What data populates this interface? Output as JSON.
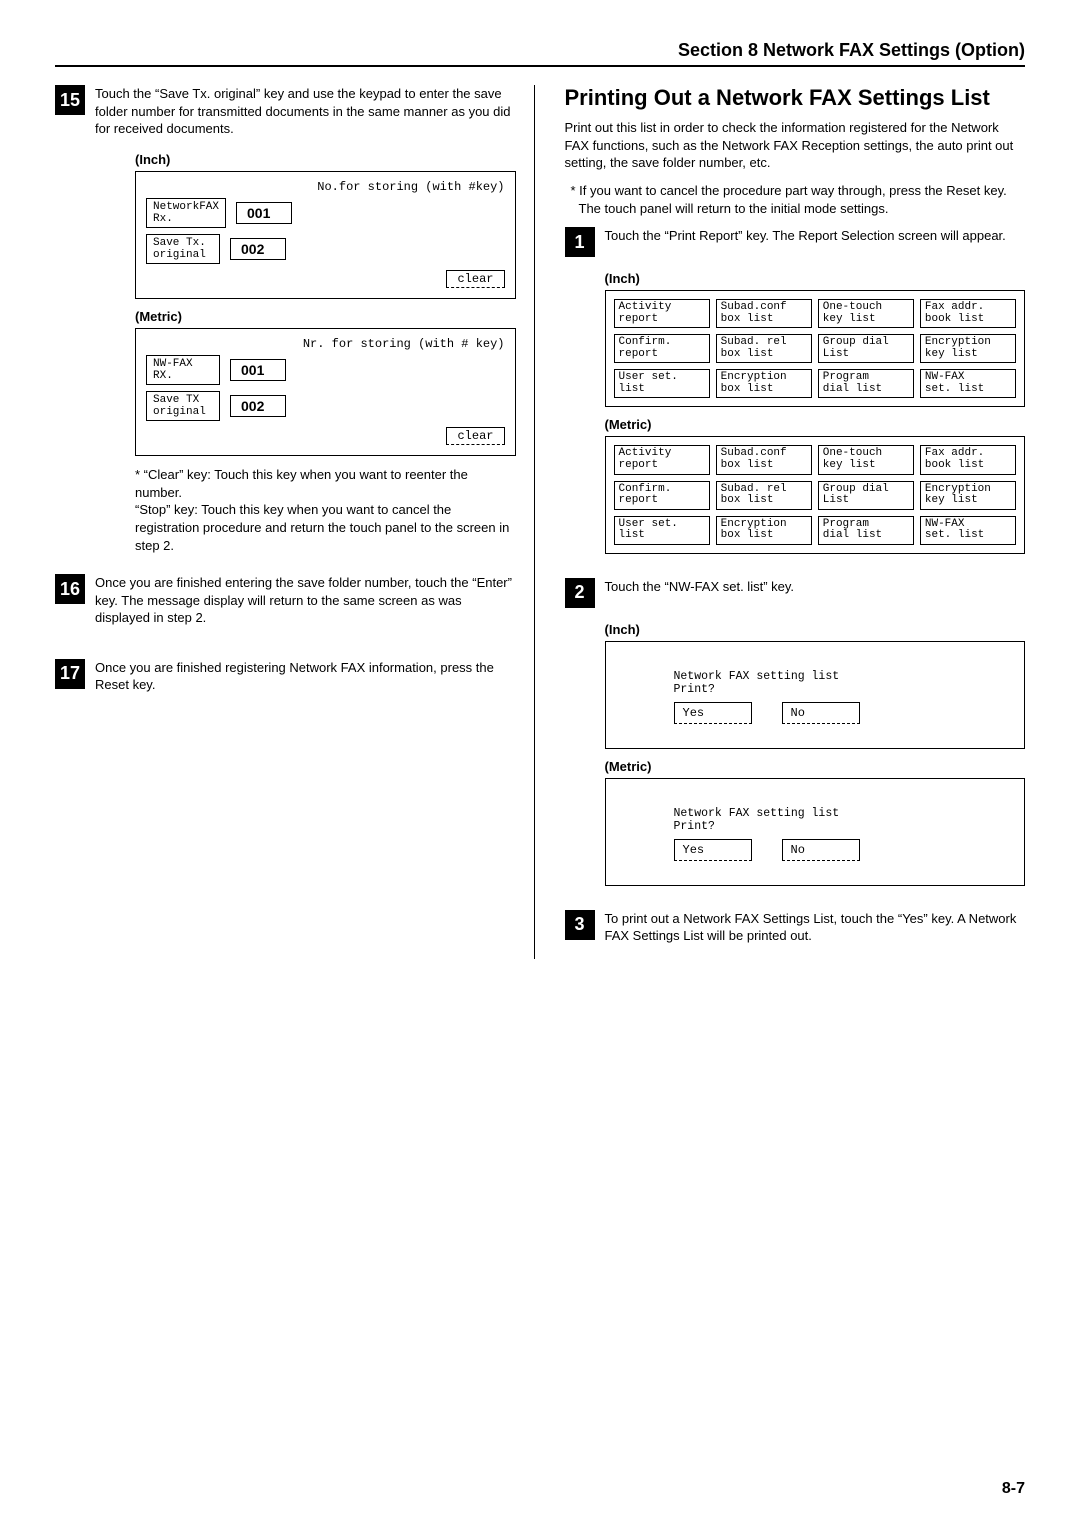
{
  "header": "Section 8 Network FAX Settings (Option)",
  "page_number": "8-7",
  "left": {
    "step15": {
      "num": "15",
      "text": "Touch the “Save Tx. original” key and use the keypad to enter the save folder number for transmitted documents in the same manner as you did for received documents."
    },
    "labels": {
      "inch": "(Inch)",
      "metric": "(Metric)"
    },
    "inch_panel": {
      "hint": "No.for storing (with #key)",
      "btn1": "NetworkFAX\nRx.",
      "val1": "001",
      "btn2": "Save Tx.\noriginal",
      "val2": "002",
      "clear": "clear"
    },
    "metric_panel": {
      "hint": "Nr. for storing (with # key)",
      "btn1": "NW-FAX\nRX.",
      "val1": "001",
      "btn2": "Save TX\noriginal",
      "val2": "002",
      "clear": "clear"
    },
    "note": "* “Clear” key: Touch this key when you want to reenter the number.\n“Stop” key: Touch this key when you want to cancel the registration procedure and return the touch panel to the screen in step 2.",
    "step16": {
      "num": "16",
      "text": "Once you are finished entering the save folder number, touch the “Enter” key. The message display will return to the same screen as was displayed in step 2."
    },
    "step17": {
      "num": "17",
      "text": "Once you are finished registering Network FAX information, press the Reset key."
    }
  },
  "right": {
    "title": "Printing Out a Network FAX Settings List",
    "intro": "Print out this list in order to check the information registered for the Network FAX functions, such as the Network FAX Reception settings, the auto print out setting, the save folder number, etc.",
    "cancel_note": "* If you want to cancel the procedure part way through, press the Reset key. The touch panel will return to the initial mode settings.",
    "step1": {
      "num": "1",
      "text": "Touch the “Print Report” key. The Report Selection screen will appear."
    },
    "labels": {
      "inch": "(Inch)",
      "metric": "(Metric)"
    },
    "report_inch": {
      "b": [
        "Activity\nreport",
        "Subad.conf\nbox list",
        "One-touch\nkey list",
        "Fax addr.\nbook list",
        "Confirm.\nreport",
        "Subad. rel\nbox list",
        "Group dial\nList",
        "Encryption\nkey list",
        "User set.\nlist",
        "Encryption\nbox list",
        "Program\ndial list",
        "NW-FAX\nset. list"
      ]
    },
    "report_metric": {
      "b": [
        "Activity\nreport",
        "Subad.conf\nbox list",
        "One-touch\nkey list",
        "Fax addr.\nbook list",
        "Confirm.\nreport",
        "Subad. rel\nbox list",
        "Group dial\nList",
        "Encryption\nkey list",
        "User set.\nlist",
        "Encryption\nbox list",
        "Program\ndial list",
        "NW-FAX\nset. list"
      ]
    },
    "step2": {
      "num": "2",
      "text": "Touch the “NW-FAX set. list” key."
    },
    "confirm_inch": {
      "prompt": "Network FAX setting list\nPrint?",
      "yes": "Yes",
      "no": "No"
    },
    "confirm_metric": {
      "prompt": "Network FAX setting list\nPrint?",
      "yes": "Yes",
      "no": "No"
    },
    "step3": {
      "num": "3",
      "text": "To print out a Network FAX Settings List, touch the “Yes” key. A Network FAX Settings List will be printed out."
    }
  }
}
